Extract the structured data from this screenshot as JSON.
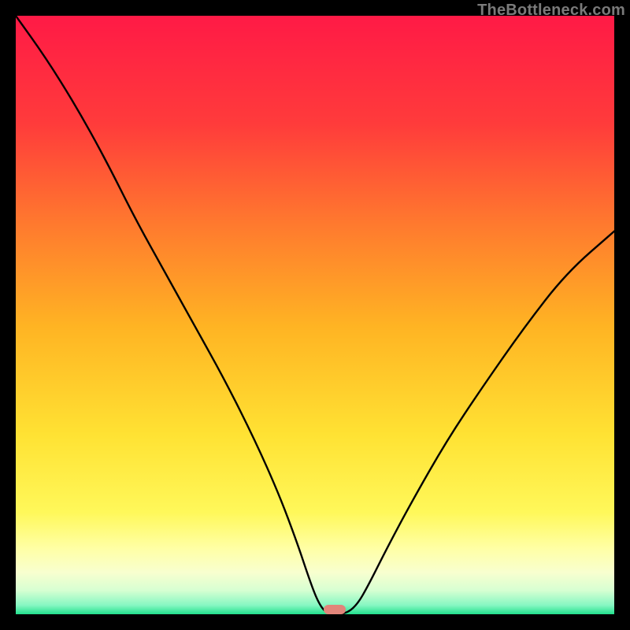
{
  "watermark": "TheBottleneck.com",
  "colors": {
    "gradient_stops": [
      {
        "pct": 0.0,
        "hex": "#ff1a46"
      },
      {
        "pct": 0.18,
        "hex": "#ff3b3b"
      },
      {
        "pct": 0.35,
        "hex": "#ff7a2e"
      },
      {
        "pct": 0.52,
        "hex": "#ffb423"
      },
      {
        "pct": 0.7,
        "hex": "#ffe233"
      },
      {
        "pct": 0.83,
        "hex": "#fff85a"
      },
      {
        "pct": 0.89,
        "hex": "#ffffa5"
      },
      {
        "pct": 0.93,
        "hex": "#f8ffcf"
      },
      {
        "pct": 0.96,
        "hex": "#d7ffd2"
      },
      {
        "pct": 0.985,
        "hex": "#86f7c2"
      },
      {
        "pct": 1.0,
        "hex": "#22e08d"
      }
    ],
    "curve": "#000000",
    "marker": "#e2857a",
    "frame": "#000000"
  },
  "chart_data": {
    "type": "line",
    "title": "",
    "xlabel": "",
    "ylabel": "",
    "xlim": [
      0,
      100
    ],
    "ylim": [
      0,
      100
    ],
    "optimum_x": 53,
    "curve_points": [
      {
        "x": 0.0,
        "y": 100.0
      },
      {
        "x": 5.0,
        "y": 93.0
      },
      {
        "x": 10.0,
        "y": 85.0
      },
      {
        "x": 15.0,
        "y": 76.0
      },
      {
        "x": 20.0,
        "y": 66.0
      },
      {
        "x": 25.0,
        "y": 57.0
      },
      {
        "x": 30.0,
        "y": 48.0
      },
      {
        "x": 35.0,
        "y": 39.0
      },
      {
        "x": 40.0,
        "y": 29.0
      },
      {
        "x": 44.0,
        "y": 20.0
      },
      {
        "x": 47.0,
        "y": 12.0
      },
      {
        "x": 49.0,
        "y": 6.0
      },
      {
        "x": 50.5,
        "y": 2.0
      },
      {
        "x": 52.0,
        "y": 0.0
      },
      {
        "x": 55.0,
        "y": 0.0
      },
      {
        "x": 57.0,
        "y": 1.5
      },
      {
        "x": 59.0,
        "y": 5.0
      },
      {
        "x": 62.0,
        "y": 11.0
      },
      {
        "x": 66.0,
        "y": 18.5
      },
      {
        "x": 72.0,
        "y": 29.0
      },
      {
        "x": 78.0,
        "y": 38.0
      },
      {
        "x": 85.0,
        "y": 48.0
      },
      {
        "x": 92.0,
        "y": 57.0
      },
      {
        "x": 100.0,
        "y": 64.0
      }
    ],
    "marker": {
      "x": 53.3,
      "y": 0.0,
      "w": 3.8,
      "h": 1.6
    }
  }
}
